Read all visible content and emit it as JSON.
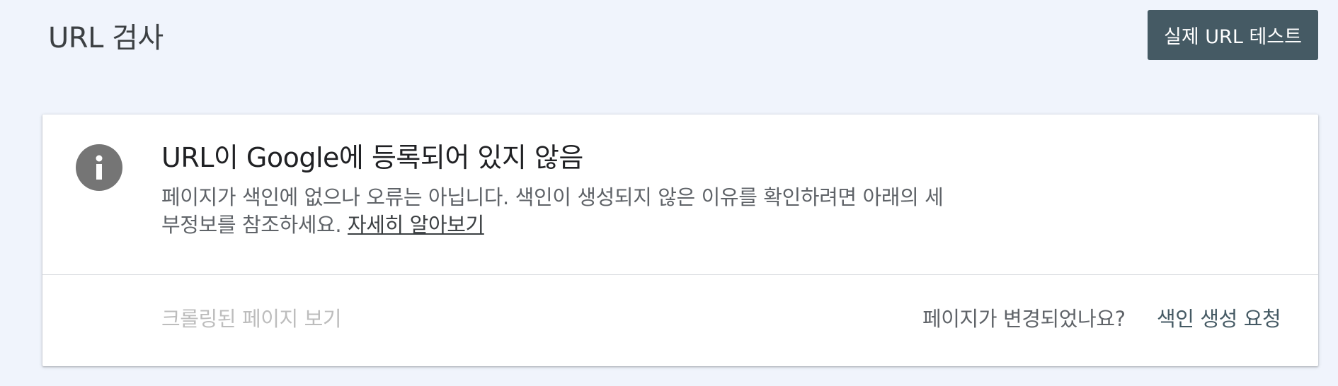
{
  "header": {
    "title": "URL 검사",
    "live_test_label": "실제 URL 테스트"
  },
  "status_card": {
    "icon": "info-icon",
    "heading": "URL이 Google에 등록되어 있지 않음",
    "description_line1": "페이지가 색인에 없으나 오류는 아닙니다. 색인이 생성되지 않은 이유를 확인하려면 아래의 세",
    "description_line2": "부정보를 참조하세요.",
    "learn_more_label": "자세히 알아보기",
    "view_crawled_label": "크롤링된 페이지 보기",
    "page_changed_label": "페이지가 변경되었나요?",
    "request_indexing_label": "색인 생성 요청"
  },
  "colors": {
    "background": "#f0f4fc",
    "button_bg": "#455a64",
    "icon_gray": "#757575",
    "disabled_text": "#bdbdbd"
  }
}
